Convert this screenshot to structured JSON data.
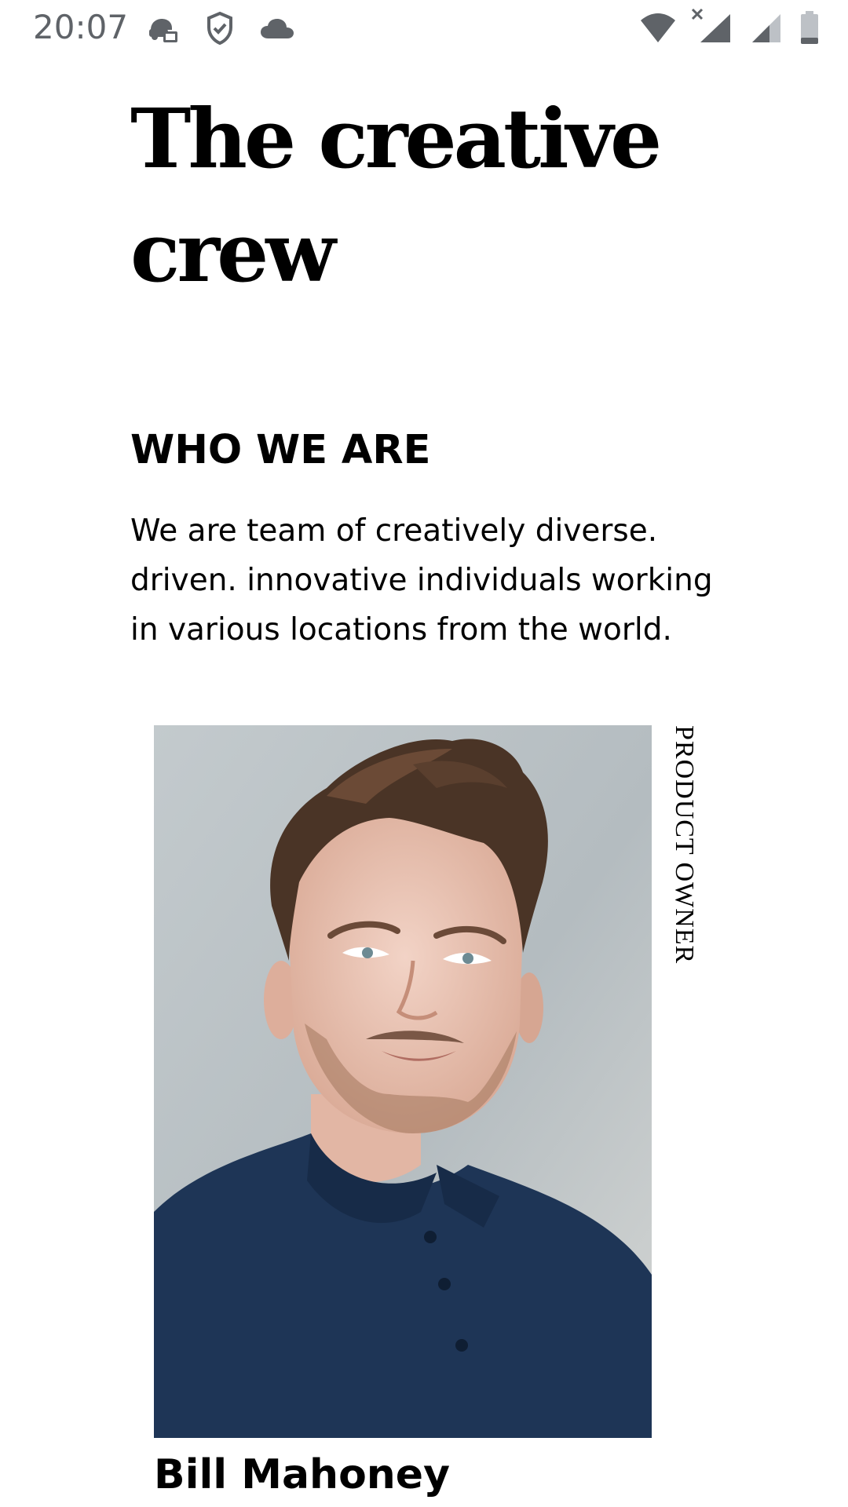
{
  "status_bar": {
    "time": "20:07",
    "icons": [
      "messaging-app-icon",
      "shield-check-icon",
      "cloud-icon",
      "wifi-icon",
      "signal-icon-no-service",
      "signal-icon",
      "battery-icon"
    ]
  },
  "page": {
    "title": "The creative crew",
    "section": {
      "heading": "WHO WE ARE",
      "body": "We are team of creatively diverse. driven. innovative individuals working in various locations from the world."
    },
    "member": {
      "role": "PRODUCT OWNER",
      "name": "Bill Mahoney"
    }
  },
  "colors": {
    "status_icon": "#5f6368",
    "photo_background": "#b6bec2",
    "shirt": "#1e3556",
    "text": "#000000"
  }
}
